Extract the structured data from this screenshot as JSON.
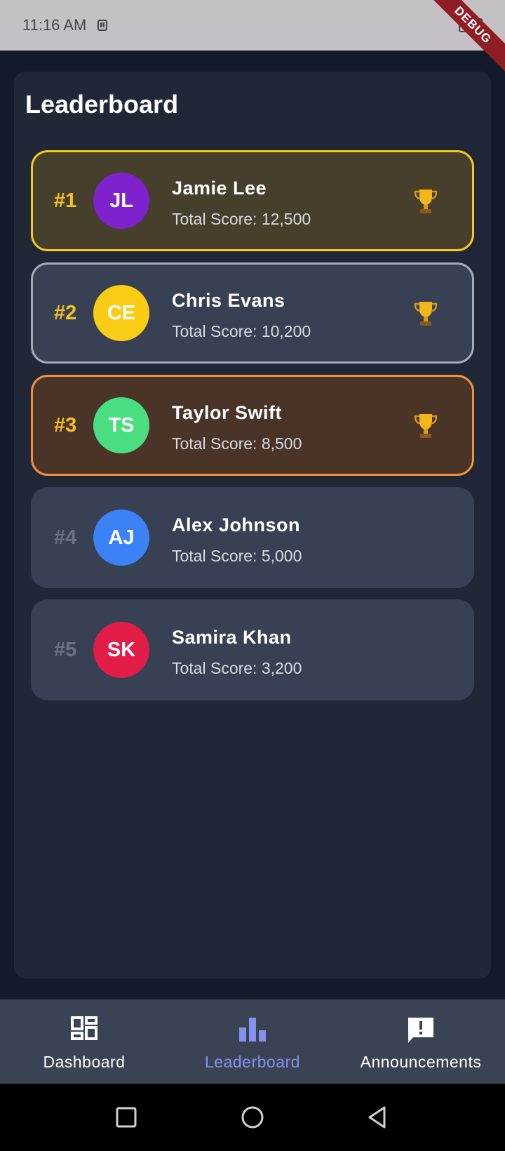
{
  "status_bar": {
    "time": "11:16 AM",
    "debug_label": "DEBUG"
  },
  "page": {
    "title": "Leaderboard"
  },
  "leaderboard": [
    {
      "rank": "#1",
      "initials": "JL",
      "name": "Jamie Lee",
      "score": "Total Score: 12,500",
      "avatar_color": "#7e22ce",
      "tier": "gold",
      "trophy": true
    },
    {
      "rank": "#2",
      "initials": "CE",
      "name": "Chris Evans",
      "score": "Total Score: 10,200",
      "avatar_color": "#facc15",
      "tier": "silver",
      "trophy": true
    },
    {
      "rank": "#3",
      "initials": "TS",
      "name": "Taylor Swift",
      "score": "Total Score: 8,500",
      "avatar_color": "#4ade80",
      "tier": "bronze",
      "trophy": true
    },
    {
      "rank": "#4",
      "initials": "AJ",
      "name": "Alex Johnson",
      "score": "Total Score: 5,000",
      "avatar_color": "#3b82f6",
      "tier": "none",
      "trophy": false
    },
    {
      "rank": "#5",
      "initials": "SK",
      "name": "Samira Khan",
      "score": "Total Score: 3,200",
      "avatar_color": "#e11d48",
      "tier": "none",
      "trophy": false
    }
  ],
  "bottom_nav": {
    "items": [
      {
        "label": "Dashboard",
        "icon": "dashboard-icon",
        "active": false
      },
      {
        "label": "Leaderboard",
        "icon": "bar-chart-icon",
        "active": true
      },
      {
        "label": "Announcements",
        "icon": "announcement-icon",
        "active": false
      }
    ]
  },
  "colors": {
    "accent": "#8690ee",
    "gold_border": "#f8c81c",
    "silver_border": "#a4aab6",
    "bronze_border": "#f5913a"
  }
}
